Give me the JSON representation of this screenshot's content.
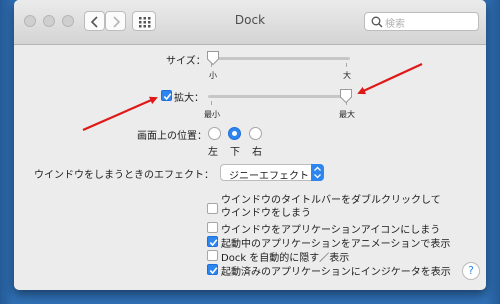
{
  "window": {
    "title": "Dock"
  },
  "search": {
    "placeholder": "検索"
  },
  "size": {
    "label": "サイズ：",
    "min_label": "小",
    "max_label": "大",
    "value": 0.0
  },
  "magnification": {
    "label": "拡大：",
    "checked": true,
    "min_label": "最小",
    "max_label": "最大",
    "value": 1.0
  },
  "position": {
    "label": "画面上の位置：",
    "options": [
      "左",
      "下",
      "右"
    ],
    "selected": "下"
  },
  "minimize_effect": {
    "label": "ウインドウをしまうときのエフェクト：",
    "value": "ジニーエフェクト"
  },
  "options": [
    {
      "label": "ウインドウのタイトルバーをダブルクリックして\nウインドウをしまう",
      "checked": false
    },
    {
      "label": "ウインドウをアプリケーションアイコンにしまう",
      "checked": false
    },
    {
      "label": "起動中のアプリケーションをアニメーションで表示",
      "checked": true
    },
    {
      "label": "Dock を自動的に隠す／表示",
      "checked": false
    },
    {
      "label": "起動済みのアプリケーションにインジケータを表示",
      "checked": true
    }
  ],
  "help": {
    "label": "?"
  },
  "colors": {
    "accent": "#2d86f0",
    "annotation_arrow": "#e01818",
    "desktop": "#2f6fb4"
  },
  "icons": [
    "close-icon",
    "minimize-icon",
    "zoom-icon",
    "chevron-left-icon",
    "chevron-right-icon",
    "grid-icon",
    "search-icon",
    "checkmark-icon",
    "popup-arrows-icon",
    "help-icon"
  ]
}
